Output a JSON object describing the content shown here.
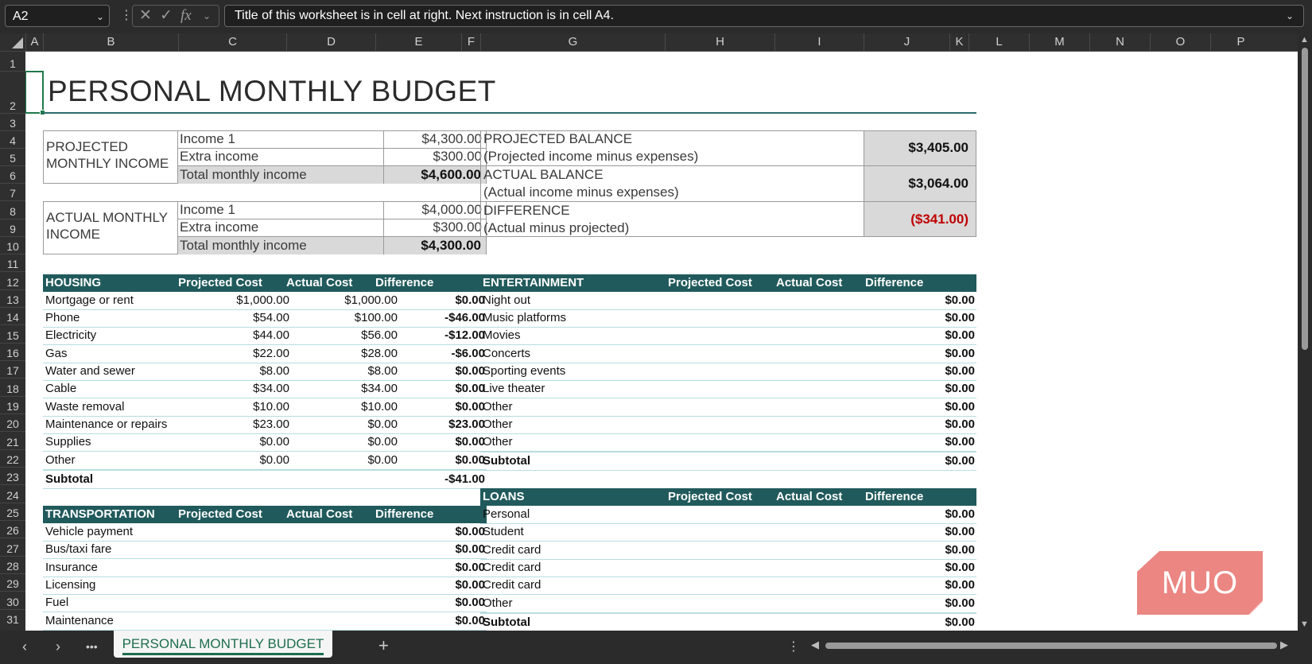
{
  "formula_bar": {
    "name_box": "A2",
    "formula": "Title of this worksheet is in cell at right. Next instruction is in cell A4."
  },
  "columns": [
    "A",
    "B",
    "C",
    "D",
    "E",
    "F",
    "G",
    "H",
    "I",
    "J",
    "K",
    "L",
    "M",
    "N",
    "O",
    "P"
  ],
  "rows": [
    "1",
    "2",
    "3",
    "4",
    "5",
    "6",
    "7",
    "8",
    "9",
    "10",
    "11",
    "12",
    "13",
    "14",
    "15",
    "16",
    "17",
    "18",
    "19",
    "20",
    "21",
    "22",
    "23",
    "24",
    "25",
    "26",
    "27",
    "28",
    "29",
    "30",
    "31"
  ],
  "title": "PERSONAL MONTHLY BUDGET",
  "projected_income": {
    "label": "PROJECTED MONTHLY INCOME",
    "rows": [
      {
        "label": "Income 1",
        "value": "$4,300.00"
      },
      {
        "label": "Extra income",
        "value": "$300.00"
      },
      {
        "label": "Total monthly income",
        "value": "$4,600.00"
      }
    ]
  },
  "actual_income": {
    "label": "ACTUAL MONTHLY INCOME",
    "rows": [
      {
        "label": "Income 1",
        "value": "$4,000.00"
      },
      {
        "label": "Extra income",
        "value": "$300.00"
      },
      {
        "label": "Total monthly income",
        "value": "$4,300.00"
      }
    ]
  },
  "balances": [
    {
      "label1": "PROJECTED BALANCE",
      "label2": "(Projected income minus expenses)",
      "value": "$3,405.00"
    },
    {
      "label1": "ACTUAL BALANCE",
      "label2": "(Actual income minus expenses)",
      "value": "$3,064.00"
    },
    {
      "label1": "DIFFERENCE",
      "label2": "(Actual minus projected)",
      "value": "($341.00)"
    }
  ],
  "housing": {
    "headers": [
      "HOUSING",
      "Projected Cost",
      "Actual Cost",
      "Difference"
    ],
    "rows": [
      {
        "item": "Mortgage or rent",
        "projected": "$1,000.00",
        "actual": "$1,000.00",
        "diff": "$0.00"
      },
      {
        "item": "Phone",
        "projected": "$54.00",
        "actual": "$100.00",
        "diff": "-$46.00"
      },
      {
        "item": "Electricity",
        "projected": "$44.00",
        "actual": "$56.00",
        "diff": "-$12.00"
      },
      {
        "item": "Gas",
        "projected": "$22.00",
        "actual": "$28.00",
        "diff": "-$6.00"
      },
      {
        "item": "Water and sewer",
        "projected": "$8.00",
        "actual": "$8.00",
        "diff": "$0.00"
      },
      {
        "item": "Cable",
        "projected": "$34.00",
        "actual": "$34.00",
        "diff": "$0.00"
      },
      {
        "item": "Waste removal",
        "projected": "$10.00",
        "actual": "$10.00",
        "diff": "$0.00"
      },
      {
        "item": "Maintenance or repairs",
        "projected": "$23.00",
        "actual": "$0.00",
        "diff": "$23.00"
      },
      {
        "item": "Supplies",
        "projected": "$0.00",
        "actual": "$0.00",
        "diff": "$0.00"
      },
      {
        "item": "Other",
        "projected": "$0.00",
        "actual": "$0.00",
        "diff": "$0.00"
      }
    ],
    "subtotal_label": "Subtotal",
    "subtotal": "-$41.00"
  },
  "transportation": {
    "headers": [
      "TRANSPORTATION",
      "Projected Cost",
      "Actual Cost",
      "Difference"
    ],
    "rows": [
      {
        "item": "Vehicle payment",
        "diff": "$0.00"
      },
      {
        "item": "Bus/taxi fare",
        "diff": "$0.00"
      },
      {
        "item": "Insurance",
        "diff": "$0.00"
      },
      {
        "item": "Licensing",
        "diff": "$0.00"
      },
      {
        "item": "Fuel",
        "diff": "$0.00"
      },
      {
        "item": "Maintenance",
        "diff": "$0.00"
      }
    ]
  },
  "entertainment": {
    "headers": [
      "ENTERTAINMENT",
      "Projected Cost",
      "Actual Cost",
      "Difference"
    ],
    "rows": [
      {
        "item": "Night out",
        "diff": "$0.00"
      },
      {
        "item": "Music platforms",
        "diff": "$0.00"
      },
      {
        "item": "Movies",
        "diff": "$0.00"
      },
      {
        "item": "Concerts",
        "diff": "$0.00"
      },
      {
        "item": "Sporting events",
        "diff": "$0.00"
      },
      {
        "item": "Live theater",
        "diff": "$0.00"
      },
      {
        "item": "Other",
        "diff": "$0.00"
      },
      {
        "item": "Other",
        "diff": "$0.00"
      },
      {
        "item": "Other",
        "diff": "$0.00"
      }
    ],
    "subtotal_label": "Subtotal",
    "subtotal": "$0.00"
  },
  "loans": {
    "headers": [
      "LOANS",
      "Projected Cost",
      "Actual Cost",
      "Difference"
    ],
    "rows": [
      {
        "item": "Personal",
        "diff": "$0.00"
      },
      {
        "item": "Student",
        "diff": "$0.00"
      },
      {
        "item": "Credit card",
        "diff": "$0.00"
      },
      {
        "item": "Credit card",
        "diff": "$0.00"
      },
      {
        "item": "Credit card",
        "diff": "$0.00"
      },
      {
        "item": "Other",
        "diff": "$0.00"
      }
    ],
    "subtotal_label": "Subtotal",
    "subtotal": "$0.00"
  },
  "sheet_tab": "PERSONAL MONTHLY BUDGET",
  "watermark": "MUO",
  "colors": {
    "header_teal": "#215a5c",
    "negative_red": "#c00000",
    "accent_green": "#1e6e4e"
  }
}
